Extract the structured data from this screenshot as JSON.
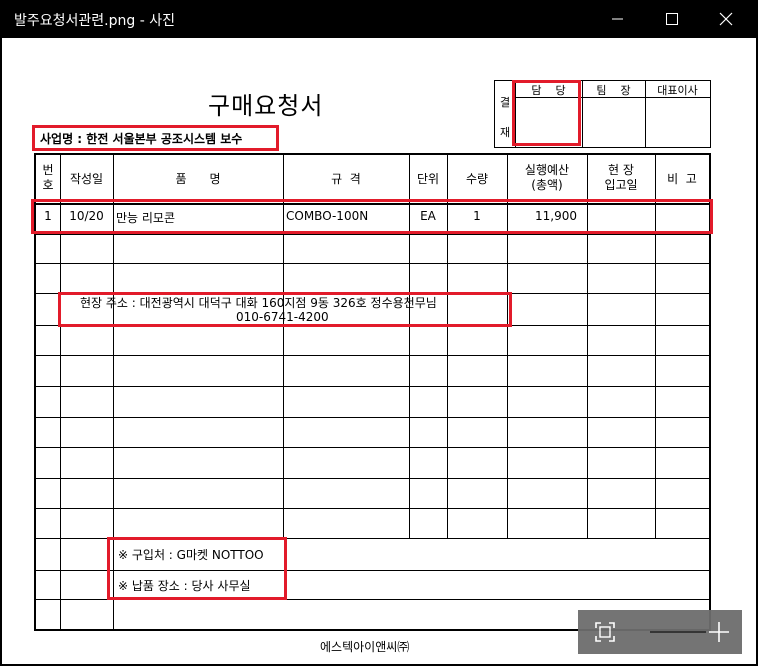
{
  "window": {
    "title": "발주요청서관련.png - 사진"
  },
  "document": {
    "title": "구매요청서",
    "project": "사업명 : 한전 서울본부 공조시스템 보수",
    "approval": {
      "side_label_top": "결",
      "side_label_bottom": "재",
      "columns": [
        "담    당",
        "팀    장",
        "대표이사"
      ]
    },
    "table": {
      "headers": {
        "no": "번\n호",
        "no_top": "번",
        "no_bottom": "호",
        "date": "작성일",
        "item": "품      명",
        "spec": "규  격",
        "unit": "단위",
        "qty": "수량",
        "budget_top": "실행예산",
        "budget_bottom": "(총액)",
        "site_top": "현 장",
        "site_bottom": "입고일",
        "remarks": "비  고"
      },
      "rows": [
        {
          "no": "1",
          "date": "10/20",
          "item": "만능 리모콘",
          "spec": "COMBO-100N",
          "unit": "EA",
          "qty": "1",
          "budget": "11,900",
          "site_date": "",
          "remarks": ""
        }
      ]
    },
    "site_address": "현장 주소 : 대전광역시 대덕구 대화 160지점 9동 326호 정수용천무님",
    "site_phone": "010-6741-4200",
    "supplier": "※  구입처 : G마켓 NOTTOO",
    "delivery": "※  납품 장소 : 당사 사무실",
    "company": "에스텍아이앤씨㈜"
  },
  "colors": {
    "highlight": "#e21b2a",
    "toolbar": "#6d6d6d"
  },
  "icons": {
    "fit": "fit-to-window-icon",
    "zoom_in": "plus-icon",
    "minimize": "minimize-icon",
    "maximize": "maximize-icon",
    "close": "close-icon"
  }
}
